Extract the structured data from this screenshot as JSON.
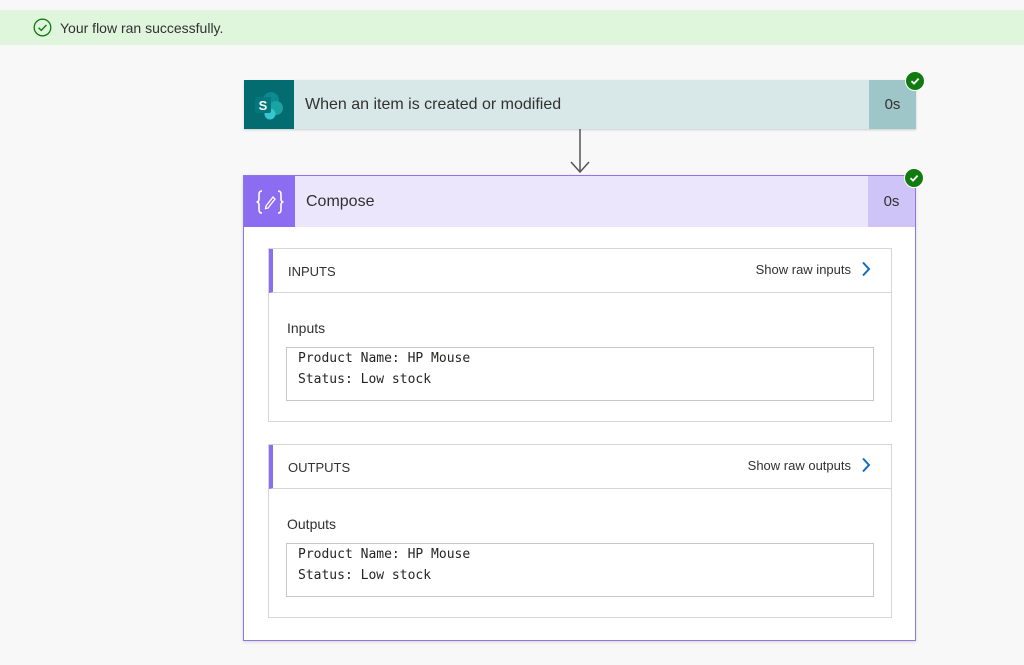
{
  "banner": {
    "message": "Your flow ran successfully.",
    "color": "#dff6dd"
  },
  "trigger": {
    "title": "When an item is created or modified",
    "duration": "0s",
    "icon": "sharepoint-icon",
    "status": "succeeded"
  },
  "compose": {
    "title": "Compose",
    "duration": "0s",
    "icon": "compose-braces-icon",
    "status": "succeeded",
    "inputs": {
      "heading": "INPUTS",
      "show_raw_label": "Show raw inputs",
      "field_label": "Inputs",
      "lines": [
        "Product Name: HP Mouse",
        "Status: Low stock"
      ]
    },
    "outputs": {
      "heading": "OUTPUTS",
      "show_raw_label": "Show raw outputs",
      "field_label": "Outputs",
      "lines": [
        "Product Name: HP Mouse",
        "Status: Low stock"
      ]
    }
  },
  "colors": {
    "success": "#107c10",
    "sharepoint": "#036c70",
    "compose_accent": "#8c6cf0",
    "link": "#0f6cbd"
  }
}
